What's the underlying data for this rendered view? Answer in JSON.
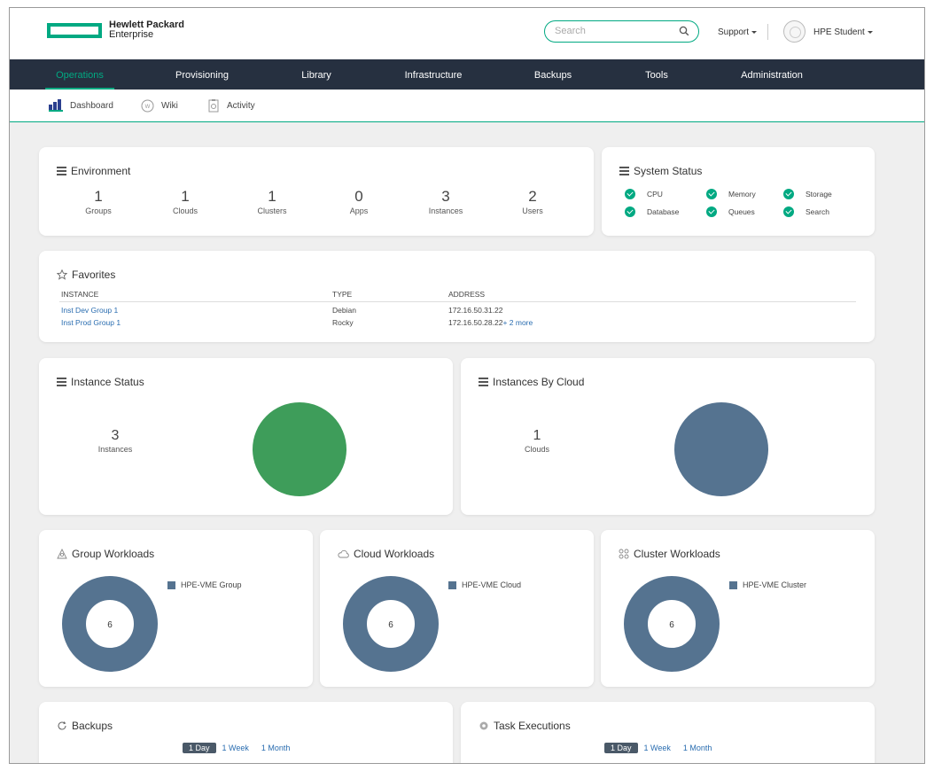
{
  "header": {
    "logo_line1": "Hewlett Packard",
    "logo_line2": "Enterprise",
    "search_placeholder": "Search",
    "support_label": "Support",
    "user_label": "HPE Student"
  },
  "nav": {
    "items": [
      "Operations",
      "Provisioning",
      "Library",
      "Infrastructure",
      "Backups",
      "Tools",
      "Administration"
    ],
    "active": "Operations"
  },
  "subnav": {
    "items": [
      {
        "label": "Dashboard",
        "icon": "bar-chart-icon"
      },
      {
        "label": "Wiki",
        "icon": "wiki-icon"
      },
      {
        "label": "Activity",
        "icon": "activity-icon"
      }
    ]
  },
  "environment": {
    "title": "Environment",
    "stats": [
      {
        "value": "1",
        "label": "Groups"
      },
      {
        "value": "1",
        "label": "Clouds"
      },
      {
        "value": "1",
        "label": "Clusters"
      },
      {
        "value": "0",
        "label": "Apps"
      },
      {
        "value": "3",
        "label": "Instances"
      },
      {
        "value": "2",
        "label": "Users"
      }
    ]
  },
  "system_status": {
    "title": "System Status",
    "items": [
      "CPU",
      "Memory",
      "Storage",
      "Database",
      "Queues",
      "Search"
    ],
    "status_color": "#01a982"
  },
  "favorites": {
    "title": "Favorites",
    "columns": [
      "INSTANCE",
      "TYPE",
      "ADDRESS"
    ],
    "rows": [
      {
        "instance": "Inst Dev Group 1",
        "type": "Debian",
        "address": "172.16.50.31.22",
        "more": ""
      },
      {
        "instance": "Inst Prod Group 1",
        "type": "Rocky",
        "address": "172.16.50.28.22",
        "more": "+ 2 more"
      }
    ]
  },
  "instance_status": {
    "title": "Instance Status",
    "value": "3",
    "label": "Instances",
    "pie_color": "#3e9d5a"
  },
  "instances_by_cloud": {
    "title": "Instances By Cloud",
    "value": "1",
    "label": "Clouds",
    "pie_color": "#557390"
  },
  "workloads": [
    {
      "title": "Group Workloads",
      "icon": "group-icon",
      "legend": "HPE-VME Group",
      "value": "6"
    },
    {
      "title": "Cloud Workloads",
      "icon": "cloud-icon",
      "legend": "HPE-VME Cloud",
      "value": "6"
    },
    {
      "title": "Cluster Workloads",
      "icon": "cluster-icon",
      "legend": "HPE-VME Cluster",
      "value": "6"
    }
  ],
  "donut_color": "#557390",
  "backups": {
    "title": "Backups",
    "ranges": [
      "1 Day",
      "1 Week",
      "1 Month"
    ],
    "selected": "1 Day"
  },
  "task_executions": {
    "title": "Task Executions",
    "ranges": [
      "1 Day",
      "1 Week",
      "1 Month"
    ],
    "selected": "1 Day"
  }
}
